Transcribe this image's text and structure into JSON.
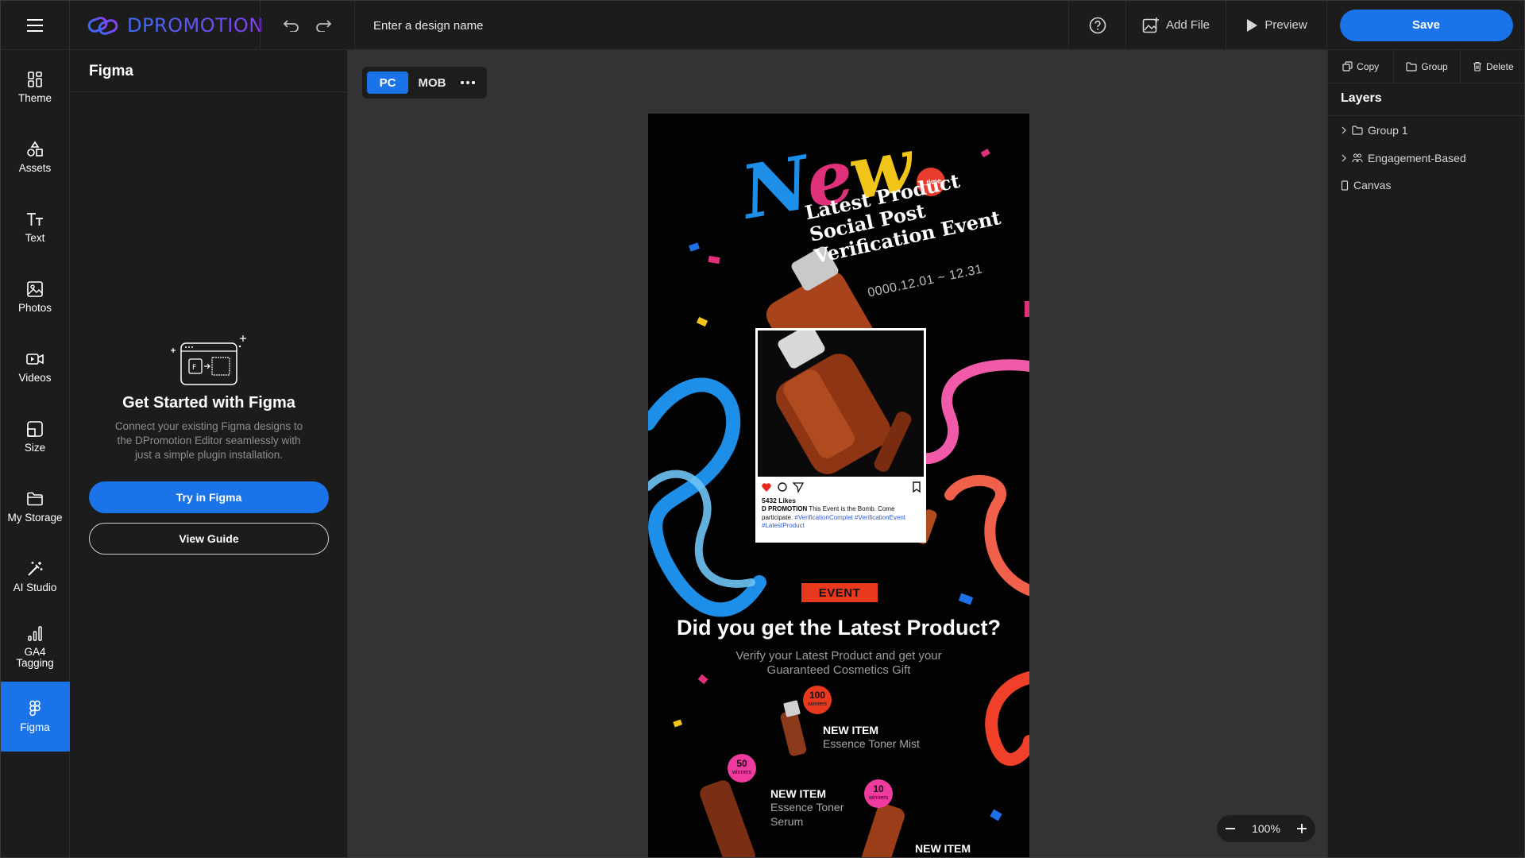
{
  "app": {
    "brand": "DPROMOTION"
  },
  "topbar": {
    "design_name_placeholder": "Enter a design name",
    "add_file_label": "Add File",
    "preview_label": "Preview",
    "save_label": "Save"
  },
  "rail": {
    "items": [
      {
        "label": "Theme",
        "icon": "theme-icon"
      },
      {
        "label": "Assets",
        "icon": "shapes-icon"
      },
      {
        "label": "Text",
        "icon": "text-icon"
      },
      {
        "label": "Photos",
        "icon": "image-icon"
      },
      {
        "label": "Videos",
        "icon": "video-icon"
      },
      {
        "label": "Size",
        "icon": "resize-icon"
      },
      {
        "label": "My Storage",
        "icon": "folder-icon"
      },
      {
        "label": "AI Studio",
        "icon": "magic-wand-icon"
      },
      {
        "label": "GA4\nTagging",
        "icon": "bar-chart-icon"
      },
      {
        "label": "Figma",
        "icon": "figma-icon",
        "active": true
      }
    ]
  },
  "left_panel": {
    "title": "Figma",
    "heading": "Get Started with Figma",
    "description": "Connect your existing Figma designs to the DPromotion Editor seamlessly with just a simple plugin installation.",
    "try_button": "Try in Figma",
    "guide_button": "View Guide"
  },
  "canvas": {
    "view_modes": [
      "PC",
      "MOB"
    ],
    "active_view": "PC",
    "zoom": "100%"
  },
  "poster": {
    "new_word": {
      "n": "N",
      "e": "e",
      "w": "w"
    },
    "badge": "1 time",
    "headline": [
      "Latest Product",
      "Social Post",
      "Verification Event"
    ],
    "date": "0000.12.01 ~ 12.31",
    "instagram": {
      "likes": "5432 Likes",
      "account": "D PROMOTION",
      "caption": "This Event is the Bomb. Come participate.",
      "tags": "#VerificationComplet #VerificationEvent #LatestProduct"
    },
    "event_badge": "EVENT",
    "question": "Did you get the Latest Product?",
    "subtitle": "Verify your Latest Product and get your Guaranteed Cosmetics Gift",
    "items": [
      {
        "title": "NEW ITEM",
        "name": "Essence Toner Mist",
        "winners": "100",
        "winners_label": "winners"
      },
      {
        "title": "NEW ITEM",
        "name": "Essence Toner Serum",
        "winners": "50",
        "winners_label": "winners"
      },
      {
        "title": "NEW ITEM",
        "winners": "10",
        "winners_label": "winners"
      }
    ],
    "colors": {
      "blue": "#1e8fe8",
      "pink": "#e0307c",
      "yellow": "#f0c418",
      "red": "#e8391f",
      "coral": "#f0604a"
    }
  },
  "right_panel": {
    "actions": [
      "Copy",
      "Group",
      "Delete"
    ],
    "layers_title": "Layers",
    "layers": [
      {
        "name": "Group 1",
        "icon": "folder-icon",
        "expandable": true
      },
      {
        "name": "Engagement-Based",
        "icon": "people-icon",
        "expandable": true
      },
      {
        "name": "Canvas",
        "icon": "rectangle-icon",
        "expandable": false
      }
    ]
  },
  "accent_color": "#1a73e8"
}
